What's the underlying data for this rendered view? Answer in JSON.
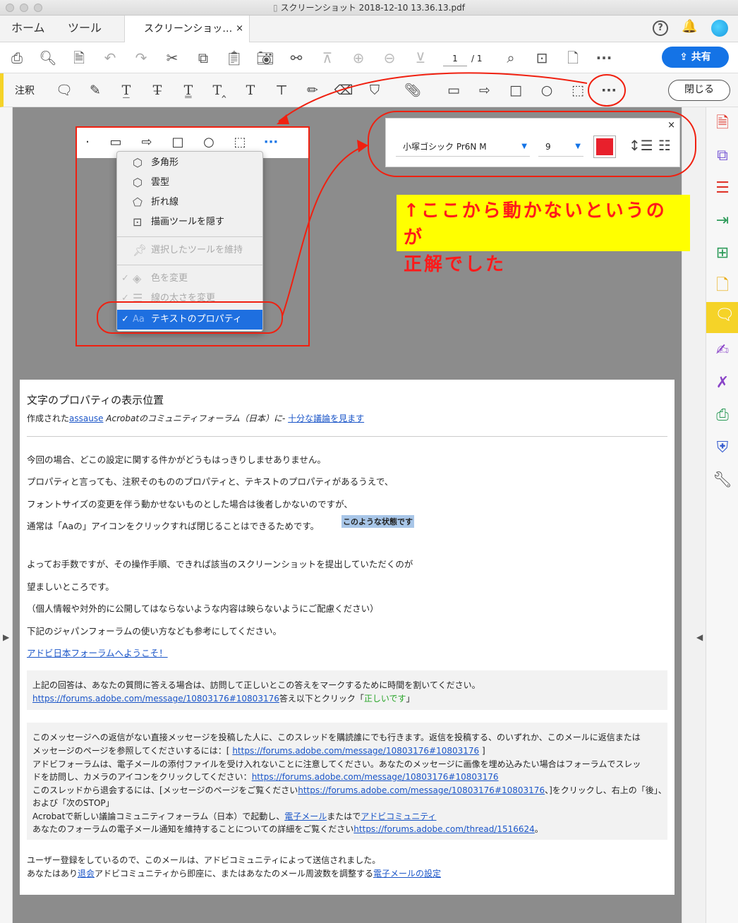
{
  "window": {
    "title": "スクリーンショット 2018-12-10 13.36.13.pdf"
  },
  "tabs": {
    "home": "ホーム",
    "tools": "ツール",
    "document": "スクリーンショッ…",
    "close": "×"
  },
  "toolbar": {
    "page_current": "1",
    "page_total": "/ 1",
    "share_label": "共有"
  },
  "commentbar": {
    "label": "注釈",
    "close_label": "閉じる"
  },
  "dropdown": {
    "items": [
      {
        "label": "多角形",
        "icon": "polygon-icon"
      },
      {
        "label": "雲型",
        "icon": "cloud-icon"
      },
      {
        "label": "折れ線",
        "icon": "polyline-icon"
      },
      {
        "label": "描画ツールを隠す",
        "icon": "hide-tools-icon"
      },
      {
        "label": "選択したツールを維持",
        "icon": "pin-icon"
      },
      {
        "label": "色を変更",
        "icon": "color-icon"
      },
      {
        "label": "線の太さを変更",
        "icon": "line-width-icon"
      },
      {
        "label": "テキストのプロパティ",
        "icon": "text-properties-icon",
        "prefix": "Aa"
      }
    ]
  },
  "props": {
    "font": "小塚ゴシック Pr6N M",
    "size": "9",
    "color": "#e8202c"
  },
  "note": {
    "line1": "↑ここから動かないというのが",
    "line2": "正解でした"
  },
  "page": {
    "title": "文字のプロパティの表示位置",
    "byline_prefix": "作成された",
    "byline_user": "assause",
    "byline_mid": " Acrobatのコミュニティフォーラム（日本）に- ",
    "byline_link": "十分な議論を見ます",
    "p1": "今回の場合、どこの設定に関する件かがどうもはっきりしませありません。",
    "p2": "プロパティと言っても、注釈そのもののプロパティと、テキストのプロパティがあるうえで、",
    "p3": "フォントサイズの変更を伴う動かせないものとした場合は後者しかないのですが、",
    "p4": "通常は「Aaの」アイコンをクリックすれば閉じることはできるためです。",
    "highlight": "このような状態です",
    "p5": "よってお手数ですが、その操作手順、できれば該当のスクリーンショットを提出していただくのが",
    "p6": "望ましいところです。",
    "p7": "（個人情報や対外的に公開してはならないような内容は映らないようにご配慮ください）",
    "p8": "下記のジャパンフォーラムの使い方なども参考にしてください。",
    "forum_link": "アドビ日本フォーラムへようこそ！",
    "box1_line1": "上記の回答は、あなたの質問に答える場合は、訪問して正しいとこの答えをマークするために時間を割いてください。",
    "box1_url": "https://forums.adobe.com/message/10803176#10803176",
    "box1_after": "答え以下とクリック「",
    "box1_correct": "正しいです",
    "box1_end": "」",
    "box2_l1": "このメッセージへの返信がない直接メッセージを投稿した人に、このスレッドを購読誰にでも行きます。返信を投稿する、のいずれか、このメールに返信または",
    "box2_l2a": "メッセージのページを参照してくださいするには：[ ",
    "box2_l2url": "https://forums.adobe.com/message/10803176#10803176",
    "box2_l2b": " ]",
    "box2_l3": "アドビフォーラムは、電子メールの添付ファイルを受け入れないことに注意してください。あなたのメッセージに画像を埋め込みたい場合はフォーラムでスレッ",
    "box2_l4a": "ドを訪問し、カメラのアイコンをクリックしてください：",
    "box2_l4url": "https://forums.adobe.com/message/10803176#10803176",
    "box2_l5a": "このスレッドから退会するには、[メッセージのページをご覧ください",
    "box2_l5url": "https://forums.adobe.com/message/10803176#10803176",
    "box2_l5b": "、]をクリックし、右上の「後」、",
    "box2_l6": "および「次のSTOP」",
    "box2_l7a": "Acrobatで新しい議論コミュニティフォーラム（日本）で起動し、",
    "box2_l7link1": "電子メール",
    "box2_l7b": "またはで",
    "box2_l7link2": "アドビコミュニティ",
    "box2_l8a": "あなたのフォーラムの電子メール通知を維持することについての詳細をご覧ください",
    "box2_l8url": "https://forums.adobe.com/thread/1516624",
    "box2_l8b": "。",
    "foot1": "ユーザー登録をしているので、このメールは、アドビコミュニティによって送信されました。",
    "foot2a": "あなたはあり",
    "foot2link1": "退会",
    "foot2b": "アドビコミュニティから即座に、またはあなたのメール周波数を調整する",
    "foot2link2": "電子メールの設定"
  },
  "colors": {
    "accent": "#1473e6",
    "annotation_red": "#f02010",
    "comment_yellow": "#f5d328"
  }
}
